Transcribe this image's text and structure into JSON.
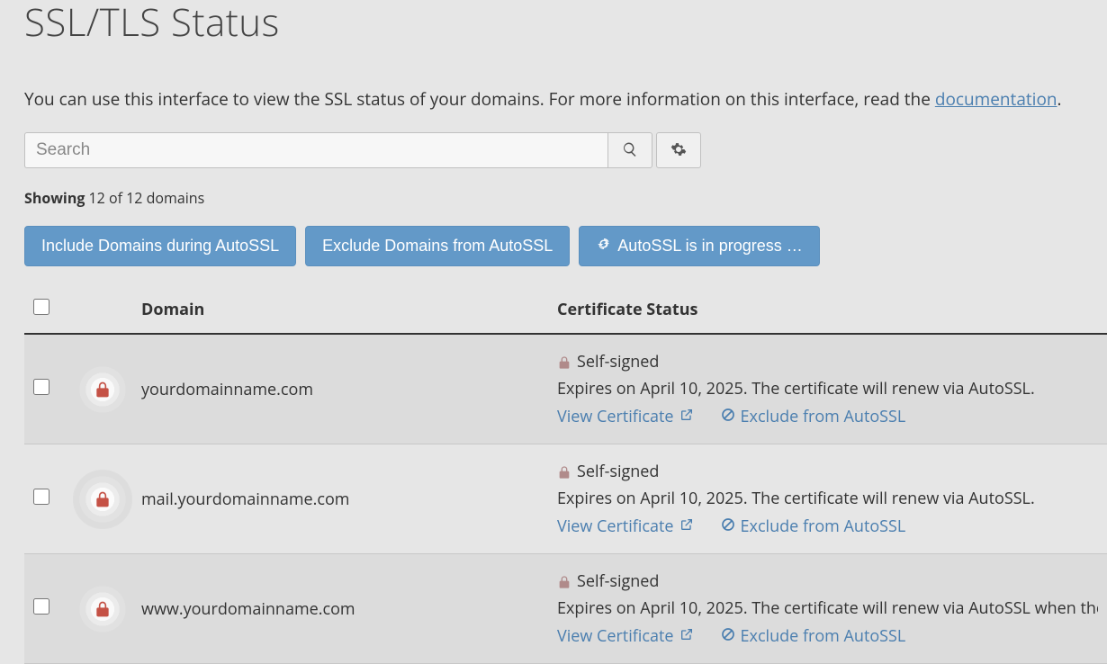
{
  "title": "SSL/TLS Status",
  "intro_prefix": "You can use this interface to view the SSL status of your domains. For more information on this interface, read the ",
  "intro_link": "documentation",
  "intro_suffix": ".",
  "search": {
    "placeholder": "Search"
  },
  "showing": {
    "label": "Showing",
    "text": "12 of 12 domains"
  },
  "buttons": {
    "include": "Include Domains during AutoSSL",
    "exclude": "Exclude Domains from AutoSSL",
    "autossl": "AutoSSL is in progress …"
  },
  "headers": {
    "domain": "Domain",
    "cert": "Certificate Status"
  },
  "actions": {
    "view": "View Certificate",
    "exclude": "Exclude from AutoSSL"
  },
  "rows": [
    {
      "domain": "yourdomainname.com",
      "status": "Self-signed",
      "expires": "Expires on April 10, 2025. The certificate will renew via AutoSSL."
    },
    {
      "domain": "mail.yourdomainname.com",
      "status": "Self-signed",
      "expires": "Expires on April 10, 2025. The certificate will renew via AutoSSL."
    },
    {
      "domain": "www.yourdomainname.com",
      "status": "Self-signed",
      "expires": "Expires on April 10, 2025. The certificate will renew via AutoSSL when the parent domain \"yourdomainname.com\" renews."
    }
  ]
}
